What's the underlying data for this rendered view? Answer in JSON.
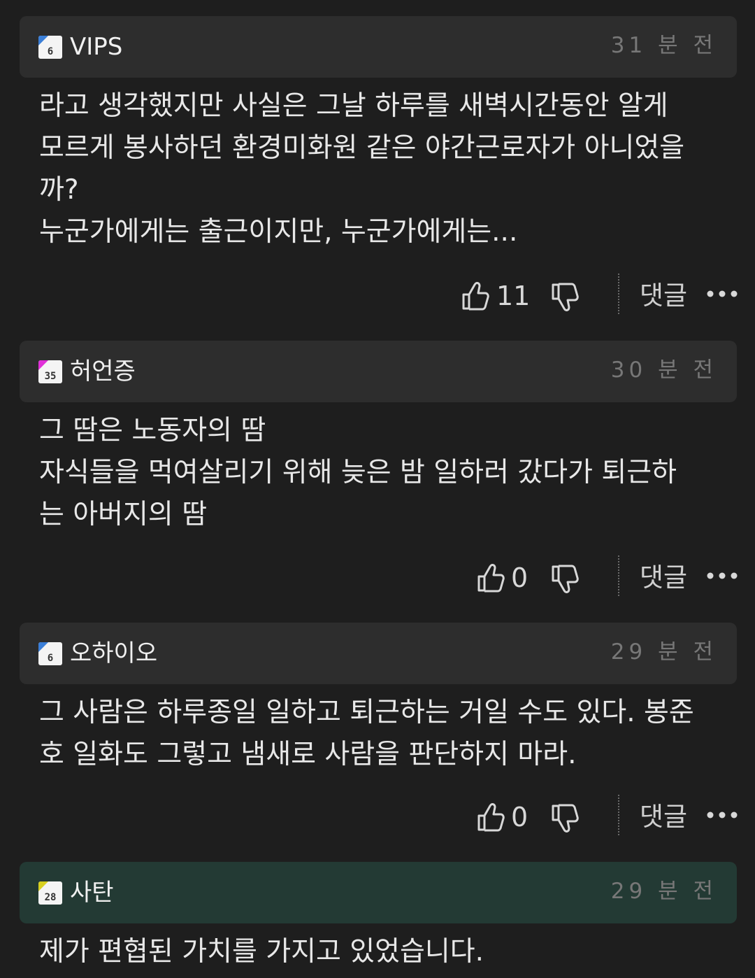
{
  "comments": [
    {
      "level": "6",
      "level_color": "#3b7fd8",
      "username": "VIPS",
      "time": "31 분 전",
      "body": "라고 생각했지만 사실은 그날 하루를 새벽시간동안 알게\n모르게 봉사하던 환경미화원 같은 야간근로자가 아니었을\n까?\n누군가에게는 출근이지만, 누군가에게는...",
      "likes": "11",
      "reply_label": "댓글",
      "highlight": false
    },
    {
      "level": "35",
      "level_color": "#e030d8",
      "username": "허언증",
      "time": "30 분 전",
      "body": "그 땀은 노동자의 땀\n자식들을 먹여살리기 위해 늦은 밤 일하러 갔다가 퇴근하\n는 아버지의 땀",
      "likes": "0",
      "reply_label": "댓글",
      "highlight": false
    },
    {
      "level": "6",
      "level_color": "#3b7fd8",
      "username": "오하이오",
      "time": "29 분 전",
      "body": "그 사람은 하루종일 일하고 퇴근하는 거일 수도 있다. 봉준\n호 일화도 그렇고 냄새로 사람을 판단하지 마라.",
      "likes": "0",
      "reply_label": "댓글",
      "highlight": false
    },
    {
      "level": "28",
      "level_color": "#d8d020",
      "username": "사탄",
      "time": "29 분 전",
      "body": "제가 편협된 가치를 가지고 있었습니다.",
      "highlight": true
    }
  ],
  "icons": {
    "like": "thumbs-up-icon",
    "dislike": "thumbs-down-icon",
    "more": "more-dots-icon"
  }
}
